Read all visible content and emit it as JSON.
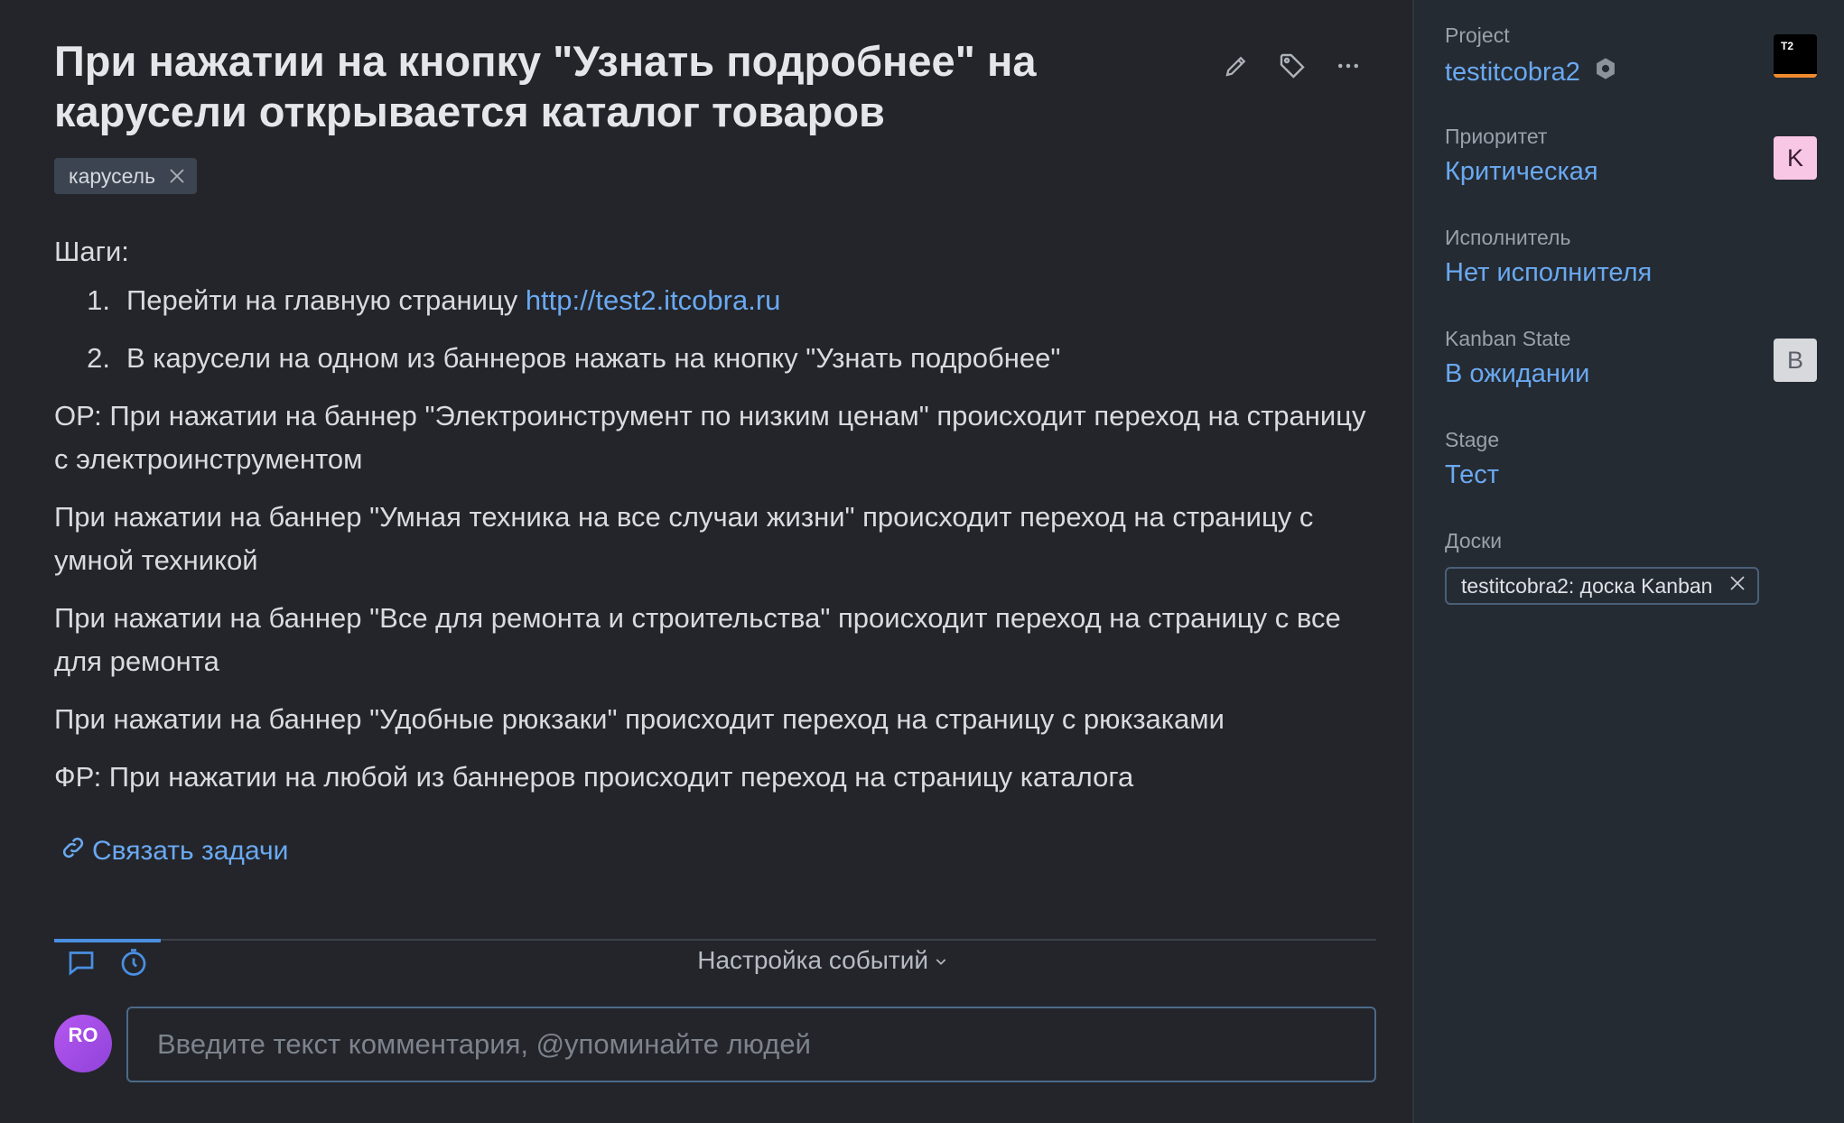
{
  "issue": {
    "title": "При нажатии на кнопку \"Узнать подробнее\" на карусели открывается каталог товаров",
    "tag": "карусель",
    "steps_label": "Шаги:",
    "steps": [
      {
        "num": "1.",
        "text": "Перейти на главную страницу ",
        "link": "http://test2.itcobra.ru"
      },
      {
        "num": "2.",
        "text": "В карусели на одном из баннеров нажать на кнопку \"Узнать подробнее\""
      }
    ],
    "paragraphs": [
      "ОР: При нажатии на баннер \"Электроинструмент по низким ценам\" происходит переход на страницу с электроинструментом",
      "При нажатии на баннер \"Умная техника на все случаи жизни\" происходит переход на страницу с умной техникой",
      "При нажатии на баннер \"Все для ремонта и строительства\" происходит переход на страницу с все для ремонта",
      "При нажатии на баннер \"Удобные рюкзаки\" происходит переход на страницу с рюкзаками",
      "ФР: При нажатии на любой из баннеров происходит переход на страницу каталога"
    ],
    "link_tasks": "Связать задачи"
  },
  "activity": {
    "settings_label": "Настройка событий",
    "avatar_initials": "RO",
    "comment_placeholder": "Введите текст комментария, @упоминайте людей"
  },
  "sidebar": {
    "project": {
      "label": "Project",
      "value": "testitcobra2",
      "badge": "T2"
    },
    "priority": {
      "label": "Приоритет",
      "value": "Критическая",
      "badge": "K"
    },
    "assignee": {
      "label": "Исполнитель",
      "value": "Нет исполнителя"
    },
    "kanban_state": {
      "label": "Kanban State",
      "value": "В ожидании",
      "badge": "B"
    },
    "stage": {
      "label": "Stage",
      "value": "Тест"
    },
    "boards": {
      "label": "Доски",
      "value": "testitcobra2: доска Kanban"
    }
  },
  "colors": {
    "link": "#6aa9f1",
    "priority_badge": "#f9c7e6",
    "state_badge": "#d7d9dc"
  }
}
